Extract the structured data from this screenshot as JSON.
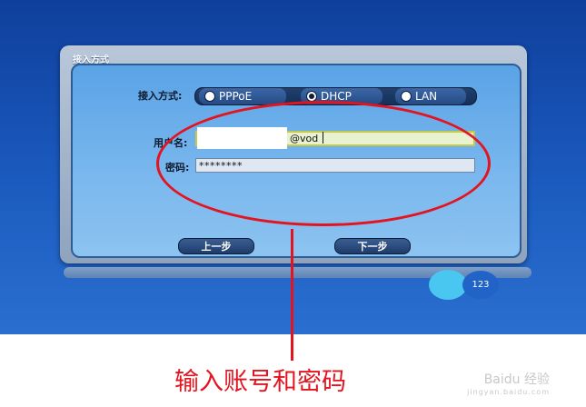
{
  "dialog": {
    "title": "接入方式",
    "connection_label": "接入方式:",
    "options": [
      {
        "label": "PPPoE",
        "selected": false
      },
      {
        "label": "DHCP",
        "selected": true
      },
      {
        "label": "LAN",
        "selected": false
      }
    ],
    "username_label": "用户名:",
    "username_suffix": "@vod",
    "password_label": "密码:",
    "password_value": "********",
    "prev_label": "上一步",
    "next_label": "下一步",
    "input_mode": "123"
  },
  "annotation": {
    "caption": "输入账号和密码",
    "color": "#e3141f"
  },
  "watermark": {
    "brand": "Baidu 经验",
    "url": "jingyan.baidu.com"
  }
}
